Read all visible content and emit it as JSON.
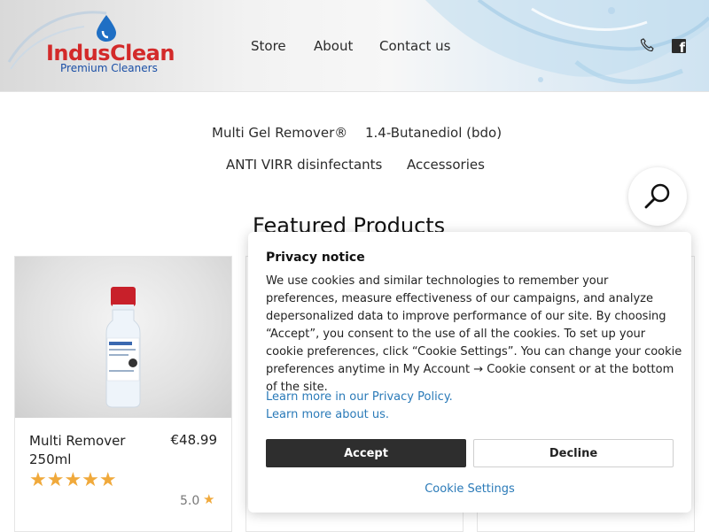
{
  "header": {
    "logo": {
      "name": "IndusClean",
      "tagline": "Premium Cleaners"
    },
    "nav": [
      {
        "label": "Store"
      },
      {
        "label": "About"
      },
      {
        "label": "Contact us"
      }
    ],
    "icons": [
      "phone-icon",
      "facebook-icon"
    ]
  },
  "categories": [
    {
      "label": "Multi Gel Remover®"
    },
    {
      "label": "1.4-Butanediol (bdo)"
    },
    {
      "label": "ANTI VIRR disinfectants"
    },
    {
      "label": "Accessories"
    }
  ],
  "search": {
    "icon": "search-icon"
  },
  "featured": {
    "heading": "Featured Products"
  },
  "products": [
    {
      "title": "Multi Remover 250ml",
      "price": "€48.99",
      "stars": "★★★★★",
      "rating": "5.0",
      "rating_star": "★"
    }
  ],
  "privacy": {
    "title": "Privacy notice",
    "body": "We use cookies and similar technologies to remember your preferences, measure effectiveness of our campaigns, and analyze depersonalized data to improve performance of our site. By choosing “Accept”, you consent to the use of all the cookies. To set up your cookie preferences, click “Cookie Settings”. You can change your cookie preferences anytime in My Account → Cookie consent or at the bottom of the site.",
    "link_policy": "Learn more in our Privacy Policy.",
    "link_about": "Learn more about us.",
    "accept_label": "Accept",
    "decline_label": "Decline",
    "settings_label": "Cookie Settings"
  },
  "colors": {
    "brand_red": "#d32a2a",
    "brand_blue": "#1a4fa6",
    "link_blue": "#2a7ab8",
    "accept_bg": "#2e2e2e",
    "star": "#f0a93b"
  }
}
